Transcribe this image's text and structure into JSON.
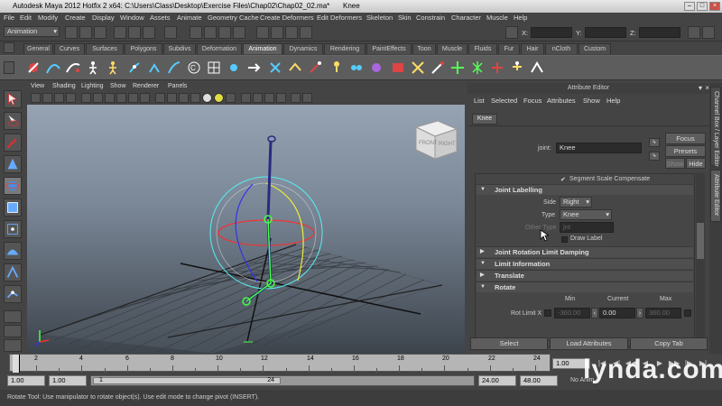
{
  "window": {
    "title": "Autodesk Maya 2012 Hotfix 2 x64: C:\\Users\\Class\\Desktop\\Exercise Files\\Chap02\\Chap02_02.ma*",
    "selection": "Knee"
  },
  "menubar": [
    "File",
    "Edit",
    "Modify",
    "Create",
    "Display",
    "Window",
    "Assets",
    "Animate",
    "Geometry Cache",
    "Create Deformers",
    "Edit Deformers",
    "Skeleton",
    "Skin",
    "Constrain",
    "Character",
    "Muscle",
    "Help"
  ],
  "statusline": {
    "mode": "Animation",
    "x_label": "X:",
    "y_label": "Y:",
    "z_label": "Z:"
  },
  "shelf_tabs": [
    "General",
    "Curves",
    "Surfaces",
    "Polygons",
    "Subdivs",
    "Deformation",
    "Animation",
    "Dynamics",
    "Rendering",
    "PaintEffects",
    "Toon",
    "Muscle",
    "Fluids",
    "Fur",
    "Hair",
    "nCloth",
    "Custom"
  ],
  "shelf_active": "Animation",
  "viewport_menu": [
    "View",
    "Shading",
    "Lighting",
    "Show",
    "Renderer",
    "Panels"
  ],
  "viewcube": {
    "left": "FRONT",
    "right": "RIGHT"
  },
  "attribute_editor": {
    "header": "Attribute Editor",
    "menu": [
      "List",
      "Selected",
      "Focus",
      "Attributes",
      "Show",
      "Help"
    ],
    "tab": "Knee",
    "joint_label": "joint:",
    "joint_value": "Knee",
    "focus": "Focus",
    "presets": "Presets",
    "show": "Show",
    "hide": "Hide",
    "segment_scale": "Segment Scale Compensate",
    "sections": {
      "joint_labelling": "Joint Labelling",
      "rotation_limit": "Joint Rotation Limit Damping",
      "limit_info": "Limit Information",
      "translate": "Translate",
      "rotate": "Rotate"
    },
    "side_label": "Side",
    "side_value": "Right",
    "type_label": "Type",
    "type_value": "Knee",
    "other_type_label": "Other Type",
    "other_type_value": "jnt",
    "draw_label": "Draw Label",
    "col_min": "Min",
    "col_current": "Current",
    "col_max": "Max",
    "rot_limit_x": "Rot Limit X",
    "min_value": "-360.00",
    "current_value": "0.00",
    "max_value": "360.00",
    "select_btn": "Select",
    "load_btn": "Load Attributes",
    "copy_btn": "Copy Tab"
  },
  "side_tabs": [
    "Channel Box / Layer Editor",
    "Attribute Editor"
  ],
  "timeline": {
    "ticks": [
      "2",
      "4",
      "6",
      "8",
      "10",
      "12",
      "14",
      "16",
      "18",
      "20",
      "22",
      "24"
    ],
    "current_frame": "1.00"
  },
  "range": {
    "start": "1.00",
    "playback_start": "1.00",
    "range_start": "1",
    "range_end": "24",
    "playback_end": "24.00",
    "end": "48.00",
    "no_anim": "No Anim"
  },
  "help_line": "Rotate Tool: Use manipulator to rotate object(s). Use edit mode to change pivot (INSERT).",
  "watermark": "lynda.com"
}
